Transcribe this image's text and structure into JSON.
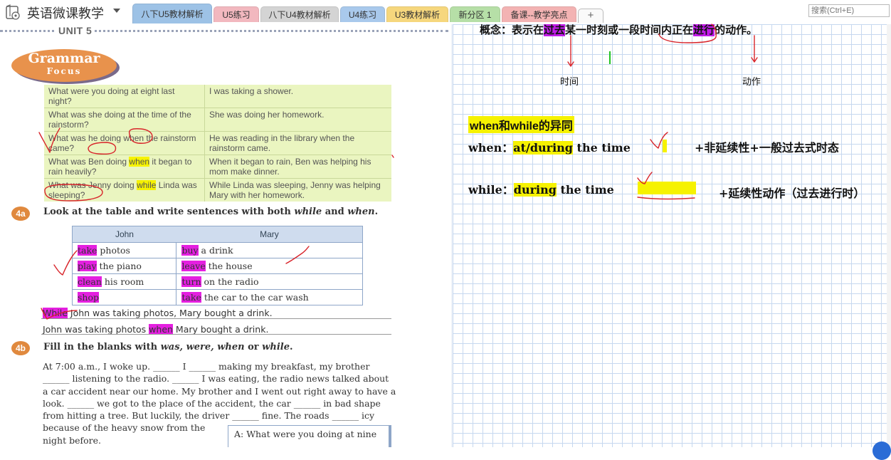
{
  "app": {
    "notebook_title": "英语微课教学"
  },
  "tabs": [
    {
      "label": "八下U5教材解析",
      "color": "#9dc2e6",
      "active": true
    },
    {
      "label": "U5练习",
      "color": "#f2b8bf",
      "active": false
    },
    {
      "label": "八下U4教材解析",
      "color": "#d4d4d4",
      "active": false
    },
    {
      "label": "U4练习",
      "color": "#a9c9ec",
      "active": false
    },
    {
      "label": "U3教材解析",
      "color": "#f6d77d",
      "active": false
    },
    {
      "label": "新分区 1",
      "color": "#b6dfa7",
      "active": false
    },
    {
      "label": "备课--教学亮点",
      "color": "#f3b3b3",
      "active": false
    }
  ],
  "add_tab": "+",
  "search": {
    "placeholder": "搜索(Ctrl+E)"
  },
  "textbook": {
    "unit": "UNIT 5",
    "grammar_focus": {
      "line1": "Grammar",
      "line2": "Focus"
    },
    "grammar_rows": [
      {
        "q_pre": "What were you doing at eight last night?",
        "q_hl": "",
        "q_post": "",
        "hl_color": "",
        "a": "I was taking a shower."
      },
      {
        "q_pre": "What was she doing at the time of the rainstorm?",
        "q_hl": "",
        "q_post": "",
        "hl_color": "",
        "a": "She was doing her homework."
      },
      {
        "q_pre": "What was he doing when the rainstorm came?",
        "q_hl": "",
        "q_post": "",
        "hl_color": "",
        "a": "He was reading in the library when the rainstorm came."
      },
      {
        "q_pre": "What was Ben doing ",
        "q_hl": "when",
        "q_post": " it began to rain heavily?",
        "hl_color": "#f6f200",
        "a": "When it began to rain, Ben was helping his mom make dinner."
      },
      {
        "q_pre": "What was Jenny doing ",
        "q_hl": "while",
        "q_post": " Linda was sleeping?",
        "hl_color": "#f6f200",
        "a": "While Linda was sleeping, Jenny was helping Mary with her homework."
      }
    ],
    "ex4a": {
      "badge": "4a",
      "instruction_pre": "Look at the table and write sentences with both ",
      "instruction_w1": "while",
      "instruction_mid": " and ",
      "instruction_w2": "when",
      "instruction_post": ".",
      "headers": [
        "John",
        "Mary"
      ],
      "rows": [
        [
          {
            "hl": "take",
            "rest": " photos"
          },
          {
            "hl": "buy",
            "rest": " a drink"
          }
        ],
        [
          {
            "hl": "play",
            "rest": " the piano"
          },
          {
            "hl": "leave",
            "rest": " the house"
          }
        ],
        [
          {
            "hl": "clean",
            "rest": " his room"
          },
          {
            "hl": "turn",
            "rest": " on the radio"
          }
        ],
        [
          {
            "hl": "shop",
            "rest": ""
          },
          {
            "hl": "take",
            "rest": " the car to the car wash"
          }
        ]
      ],
      "answer1": {
        "hl": "While",
        "rest": " John was taking photos, Mary bought a drink."
      },
      "answer2": {
        "pre": "John was taking photos ",
        "hl": "when",
        "post": " Mary bought a drink."
      }
    },
    "ex4b": {
      "badge": "4b",
      "instruction_pre": "Fill in the blanks with ",
      "instruction_words": "was, were, when",
      "instruction_mid": " or ",
      "instruction_w2": "while",
      "instruction_post": ".",
      "paragraph_lines": [
        "At 7:00 a.m., I woke up. ______ I ______ making my breakfast, my brother",
        "______ listening to the radio. ______ I was eating, the radio news talked about",
        "a car accident near our home. My brother and I went out right away to have a",
        "look. ______ we got to the place of the accident, the car ______ in bad shape",
        "from hitting a tree. But luckily, the driver ______ fine. The roads ______ icy",
        "because of the heavy snow from the",
        "night before."
      ],
      "box_text": "A: What were you doing at nine"
    }
  },
  "notes": {
    "concept_pre": "概念：表示在",
    "concept_hl1": "过去",
    "concept_mid": "某一时刻或一段时间内正在",
    "concept_hl2": "进行",
    "concept_post": "的动作。",
    "label_time": "时间",
    "label_action": "动作",
    "heading": "when和while的异同",
    "when_label": "when：",
    "when_hl": "at/during",
    "when_rest": " the time",
    "when_note": "+非延续性+一般过去式时态",
    "while_label": "while：",
    "while_hl": "during",
    "while_rest": " the time",
    "while_note": "+延续性动作（过去进行时）",
    "colors": {
      "yellow": "#f6f200",
      "magenta": "#c01be8",
      "ink_red": "#d8252b",
      "cursor_green": "#22c322"
    }
  }
}
